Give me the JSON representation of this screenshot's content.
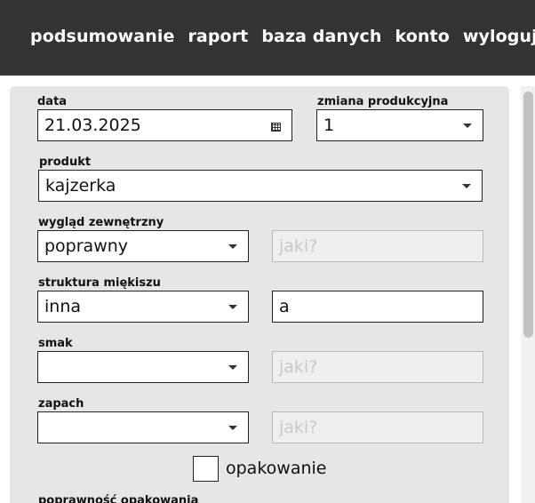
{
  "nav": {
    "items": [
      "podsumowanie",
      "raport",
      "baza danych",
      "konto",
      "wyloguj"
    ]
  },
  "form": {
    "data": {
      "label": "data",
      "value": "21.03.2025"
    },
    "zmiana": {
      "label": "zmiana produkcyjna",
      "value": "1"
    },
    "produkt": {
      "label": "produkt",
      "value": "kajzerka"
    },
    "wyglad": {
      "label": "wygląd zewnętrzny",
      "value": "poprawny",
      "detail_placeholder": "jaki?"
    },
    "struktura": {
      "label": "struktura miękiszu",
      "value": "inna",
      "detail_value": "a"
    },
    "smak": {
      "label": "smak",
      "value": "",
      "detail_placeholder": "jaki?"
    },
    "zapach": {
      "label": "zapach",
      "value": "",
      "detail_placeholder": "jaki?"
    },
    "opakowanie": {
      "label": "opakowanie",
      "checked": false
    },
    "poprawnosc": {
      "label": "poprawność opakowania"
    }
  },
  "colors": {
    "topbar": "#333333",
    "panel": "#e6e6e6"
  }
}
